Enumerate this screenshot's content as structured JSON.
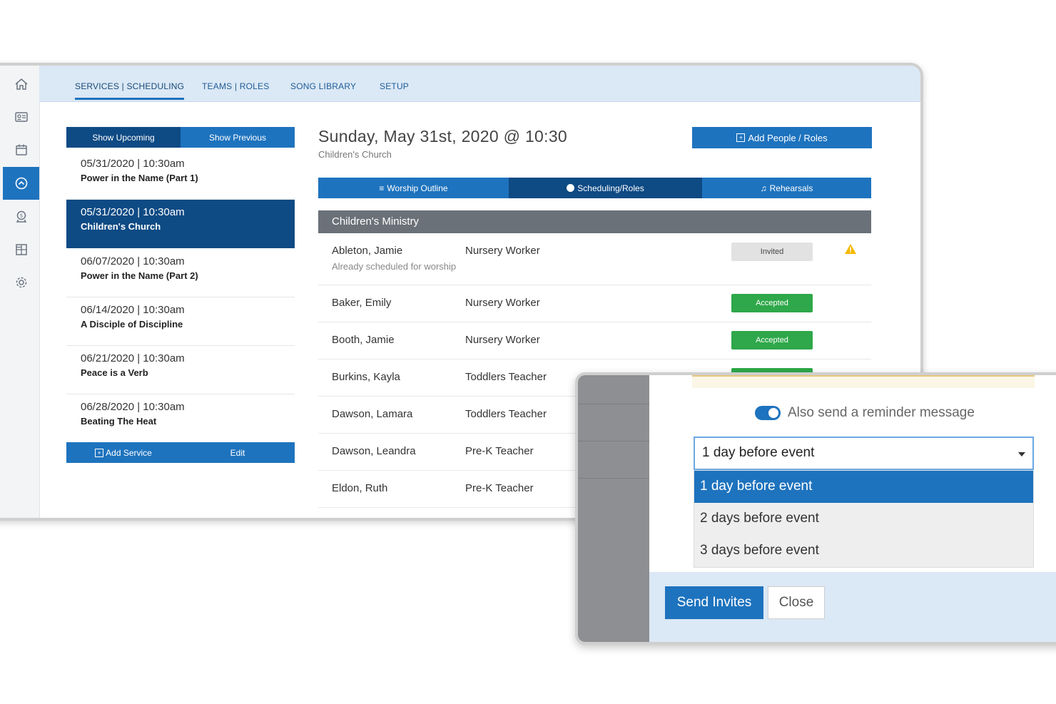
{
  "nav": {
    "tabs": [
      "SERVICES | SCHEDULING",
      "TEAMS | ROLES",
      "SONG LIBRARY",
      "SETUP"
    ]
  },
  "rail_icons": [
    "home-icon",
    "id-card-icon",
    "calendar-icon",
    "chevron-up-circle-icon",
    "money-icon",
    "grid-icon",
    "gear-icon"
  ],
  "services": {
    "toggle": [
      "Show Upcoming",
      "Show Previous"
    ],
    "items": [
      {
        "date": "05/31/2020 | 10:30am",
        "name": "Power in the Name (Part 1)"
      },
      {
        "date": "05/31/2020 | 10:30am",
        "name": "Children's Church"
      },
      {
        "date": "06/07/2020 | 10:30am",
        "name": "Power in the Name (Part 2)"
      },
      {
        "date": "06/14/2020 | 10:30am",
        "name": "A Disciple of Discipline"
      },
      {
        "date": "06/21/2020 | 10:30am",
        "name": "Peace is a Verb"
      },
      {
        "date": "06/28/2020 | 10:30am",
        "name": "Beating The Heat"
      }
    ],
    "add_label": "Add Service",
    "edit_label": "Edit"
  },
  "detail": {
    "title": "Sunday, May 31st, 2020 @ 10:30",
    "subtitle": "Children's Church",
    "add_people_label": "Add People / Roles",
    "subtabs": [
      "Worship Outline",
      "Scheduling/Roles",
      "Rehearsals"
    ],
    "ministry": "Children's Ministry",
    "rows": [
      {
        "name": "Ableton, Jamie",
        "role": "Nursery Worker",
        "note": "Already scheduled for worship",
        "status": "Invited"
      },
      {
        "name": "Baker, Emily",
        "role": "Nursery Worker",
        "status": "Accepted"
      },
      {
        "name": "Booth, Jamie",
        "role": "Nursery Worker",
        "status": "Accepted"
      },
      {
        "name": "Burkins, Kayla",
        "role": "Toddlers Teacher",
        "status": "Accepted"
      },
      {
        "name": "Dawson, Lamara",
        "role": "Toddlers Teacher"
      },
      {
        "name": "Dawson, Leandra",
        "role": "Pre-K Teacher"
      },
      {
        "name": "Eldon, Ruth",
        "role": "Pre-K Teacher"
      }
    ]
  },
  "modal": {
    "reminder_label": "Also send a reminder message",
    "reminder_on": true,
    "selected": "1 day before event",
    "options": [
      "1 day before event",
      "2 days before event",
      "3 days before event"
    ],
    "send_label": "Send Invites",
    "close_label": "Close"
  },
  "colors": {
    "primary": "#1e73be",
    "primary_dark": "#0e4a84",
    "accepted": "#2ea84a",
    "ministry_bar": "#6b7178",
    "warning": "#f5b800"
  }
}
